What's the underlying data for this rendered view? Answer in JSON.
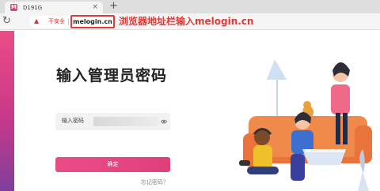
{
  "browser": {
    "tab": {
      "favicon_letter": "M",
      "title": "D191G",
      "close_glyph": "×"
    },
    "new_tab_glyph": "+",
    "reload_glyph": "↻",
    "security": {
      "warning_glyph": "▲",
      "label": "不安全"
    },
    "url": "melogin.cn"
  },
  "annotation": {
    "text": "浏览器地址栏输入melogin.cn",
    "color": "#e53935"
  },
  "login": {
    "title": "输入管理员密码",
    "password_label": "输入密码",
    "password_value": "",
    "confirm_label": "确定",
    "forgot_link": "忘记密码？"
  },
  "colors": {
    "accent": "#e0407a",
    "gradient_end": "#7f3e9c",
    "panel": "#f2f2f2"
  },
  "icons": [
    "favicon-icon",
    "close-icon",
    "plus-icon",
    "reload-icon",
    "warning-icon",
    "eye-icon"
  ]
}
